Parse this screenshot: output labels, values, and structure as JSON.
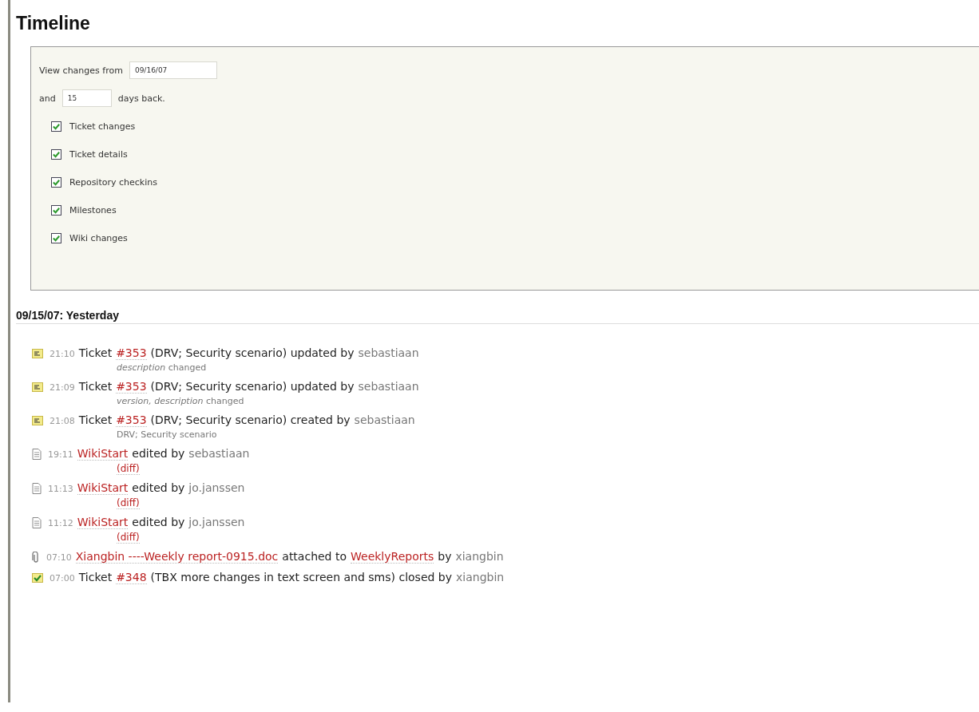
{
  "title": "Timeline",
  "filters": {
    "from_label": "View changes from",
    "from_value": "09/16/07",
    "and_label": "and",
    "days_value": "15",
    "days_label": "days back.",
    "options": [
      {
        "label": "Ticket changes",
        "checked": true
      },
      {
        "label": "Ticket details",
        "checked": true
      },
      {
        "label": "Repository checkins",
        "checked": true
      },
      {
        "label": "Milestones",
        "checked": true
      },
      {
        "label": "Wiki changes",
        "checked": true
      }
    ]
  },
  "day_heading": "09/15/07: Yesterday",
  "events": [
    {
      "kind": "ticket",
      "time": "21:10",
      "parts": [
        {
          "kind": "plain",
          "text": "Ticket"
        },
        {
          "kind": "link",
          "text": "#353"
        },
        {
          "kind": "plain",
          "text": "(DRV; Security scenario) updated by"
        },
        {
          "kind": "author",
          "text": "sebastiaan"
        }
      ],
      "detail": {
        "kind": "text",
        "text": "*description* changed"
      }
    },
    {
      "kind": "ticket",
      "time": "21:09",
      "parts": [
        {
          "kind": "plain",
          "text": "Ticket"
        },
        {
          "kind": "link",
          "text": "#353"
        },
        {
          "kind": "plain",
          "text": "(DRV; Security scenario) updated by"
        },
        {
          "kind": "author",
          "text": "sebastiaan"
        }
      ],
      "detail": {
        "kind": "text",
        "text": "*version, description* changed"
      }
    },
    {
      "kind": "ticket",
      "time": "21:08",
      "parts": [
        {
          "kind": "plain",
          "text": "Ticket"
        },
        {
          "kind": "link",
          "text": "#353"
        },
        {
          "kind": "plain",
          "text": "(DRV; Security scenario) created by"
        },
        {
          "kind": "author",
          "text": "sebastiaan"
        }
      ],
      "detail": {
        "kind": "text",
        "text": "DRV; Security scenario"
      }
    },
    {
      "kind": "wiki",
      "time": "19:11",
      "parts": [
        {
          "kind": "link",
          "text": "WikiStart"
        },
        {
          "kind": "plain",
          "text": "edited by"
        },
        {
          "kind": "author",
          "text": "sebastiaan"
        }
      ],
      "detail": {
        "kind": "link",
        "text": "(diff)"
      }
    },
    {
      "kind": "wiki",
      "time": "11:13",
      "parts": [
        {
          "kind": "link",
          "text": "WikiStart"
        },
        {
          "kind": "plain",
          "text": "edited by"
        },
        {
          "kind": "author",
          "text": "jo.janssen"
        }
      ],
      "detail": {
        "kind": "link",
        "text": "(diff)"
      }
    },
    {
      "kind": "wiki",
      "time": "11:12",
      "parts": [
        {
          "kind": "link",
          "text": "WikiStart"
        },
        {
          "kind": "plain",
          "text": "edited by"
        },
        {
          "kind": "author",
          "text": "jo.janssen"
        }
      ],
      "detail": {
        "kind": "link",
        "text": "(diff)"
      }
    },
    {
      "kind": "attachment",
      "time": "07:10",
      "parts": [
        {
          "kind": "link",
          "text": "Xiangbin ----Weekly report-0915.doc"
        },
        {
          "kind": "plain",
          "text": "attached to"
        },
        {
          "kind": "link",
          "text": "WeeklyReports"
        },
        {
          "kind": "plain",
          "text": "by"
        },
        {
          "kind": "author",
          "text": "xiangbin"
        }
      ]
    },
    {
      "kind": "closed",
      "time": "07:00",
      "parts": [
        {
          "kind": "plain",
          "text": "Ticket"
        },
        {
          "kind": "link",
          "text": "#348"
        },
        {
          "kind": "plain",
          "text": "(TBX more changes in text screen and sms) closed by"
        },
        {
          "kind": "author",
          "text": "xiangbin"
        }
      ]
    }
  ]
}
